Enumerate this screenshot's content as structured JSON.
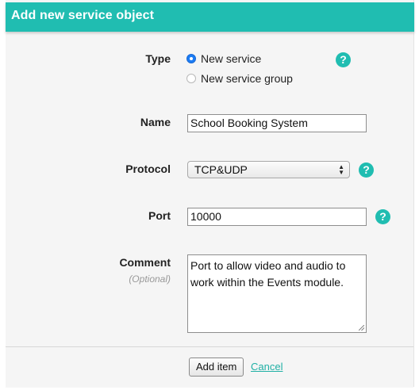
{
  "dialog": {
    "title": "Add new service object"
  },
  "form": {
    "type_label": "Type",
    "type_options": [
      {
        "label": "New service",
        "checked": true
      },
      {
        "label": "New service group",
        "checked": false
      }
    ],
    "name_label": "Name",
    "name_value": "School Booking System",
    "protocol_label": "Protocol",
    "protocol_value": "TCP&UDP",
    "port_label": "Port",
    "port_value": "10000",
    "comment_label": "Comment",
    "comment_sublabel": "(Optional)",
    "comment_value": "Port to allow video and audio to work within the Events module.",
    "help_symbol": "?"
  },
  "footer": {
    "add_label": "Add item",
    "cancel_label": "Cancel"
  },
  "colors": {
    "accent": "#20bdb1",
    "radio_selected": "#1b7cf5"
  },
  "icons": [
    "help-icon",
    "select-arrows-icon",
    "resize-grip-icon"
  ]
}
